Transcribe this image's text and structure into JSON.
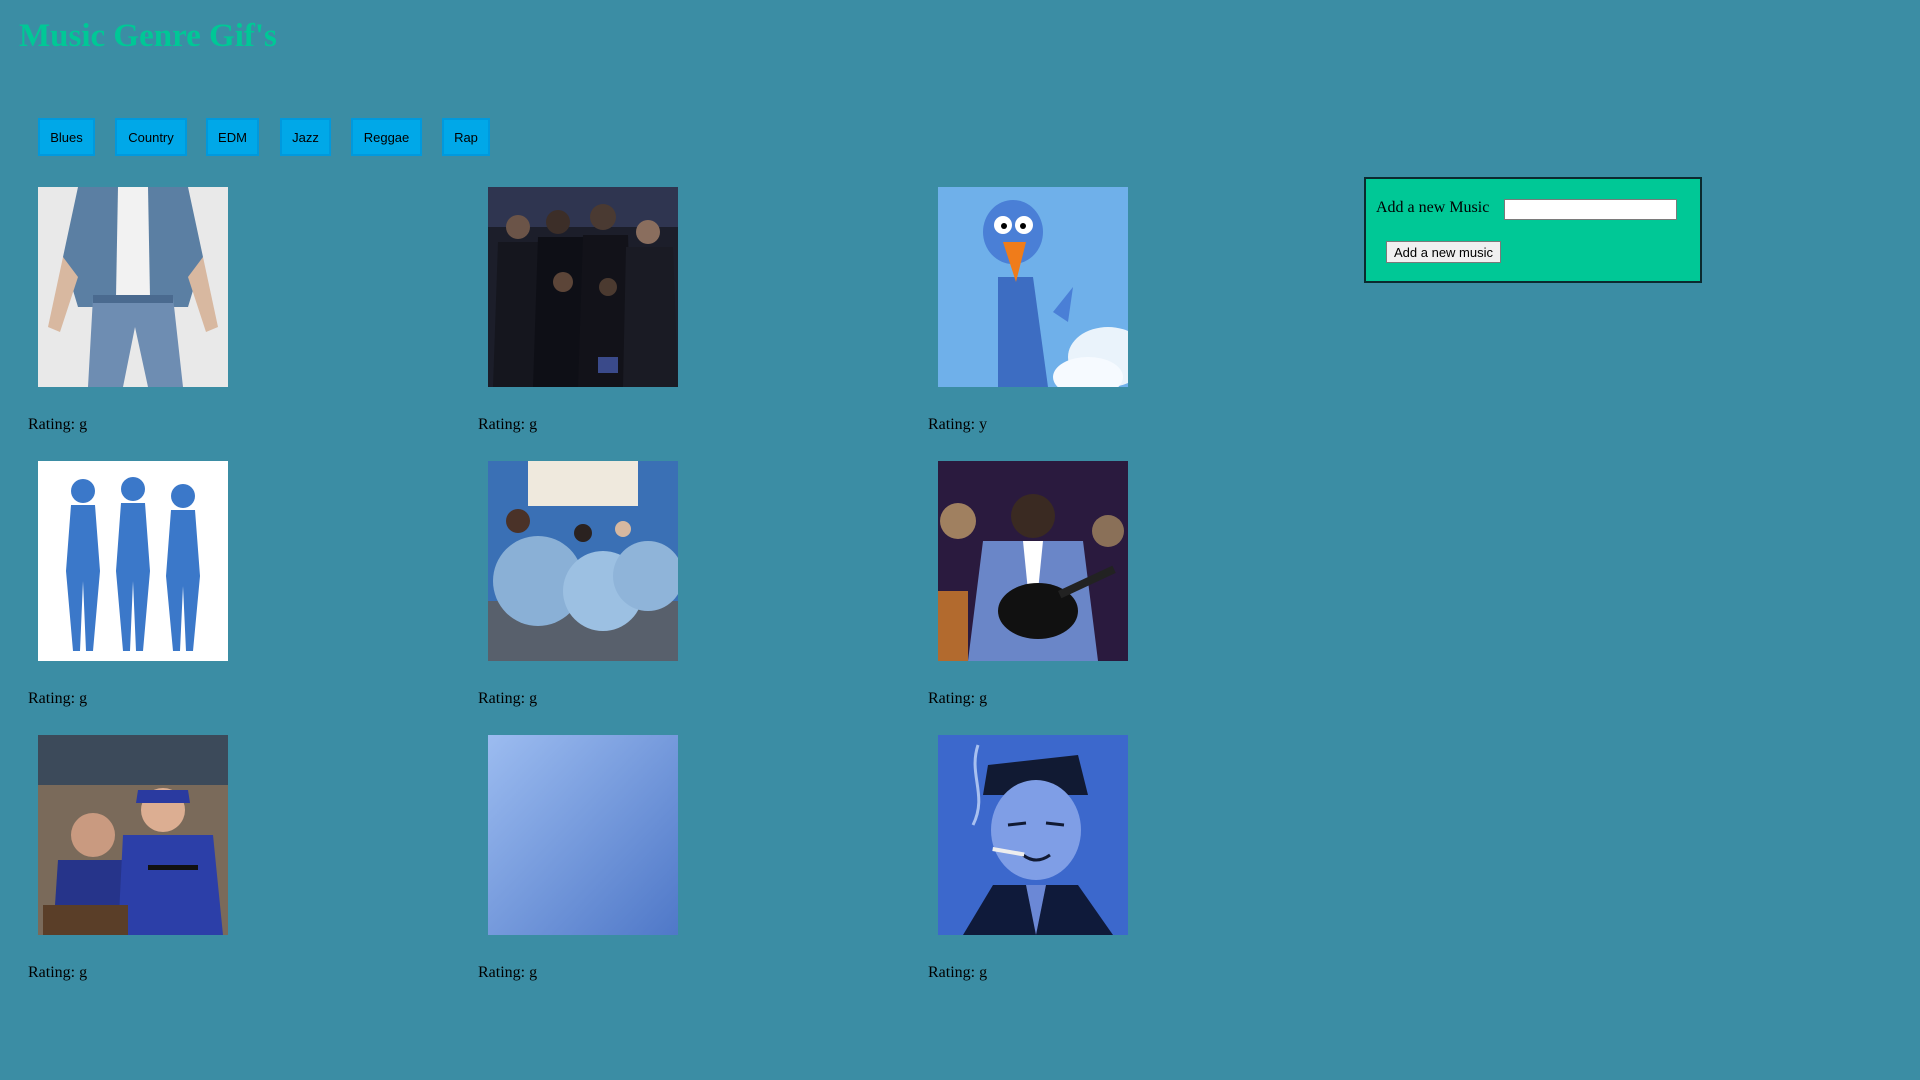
{
  "page": {
    "title": "Music Genre Gif's"
  },
  "genres": [
    {
      "label": "Blues"
    },
    {
      "label": "Country"
    },
    {
      "label": "EDM"
    },
    {
      "label": "Jazz"
    },
    {
      "label": "Reggae"
    },
    {
      "label": "Rap"
    }
  ],
  "gifs": [
    {
      "image": "denim-outfit-image",
      "rating_text": "Rating: g"
    },
    {
      "image": "audience-clapping-image",
      "rating_text": "Rating: g"
    },
    {
      "image": "cartoon-blue-bird-image",
      "rating_text": "Rating: y"
    },
    {
      "image": "blue-bodysuit-dancers-image",
      "rating_text": "Rating: g"
    },
    {
      "image": "exercise-balls-image",
      "rating_text": "Rating: g"
    },
    {
      "image": "guitarist-performing-image",
      "rating_text": "Rating: g"
    },
    {
      "image": "athlete-at-podium-image",
      "rating_text": "Rating: g"
    },
    {
      "image": "blurry-blue-image",
      "rating_text": "Rating: g"
    },
    {
      "image": "smoking-musician-illustration-image",
      "rating_text": "Rating: g"
    }
  ],
  "add_form": {
    "label": "Add a new Music",
    "input_value": "",
    "button_label": "Add a new music"
  },
  "colors": {
    "background": "#3b8da4",
    "title": "#00c896",
    "genre_button": "#00a8e8",
    "panel": "#00c896"
  }
}
